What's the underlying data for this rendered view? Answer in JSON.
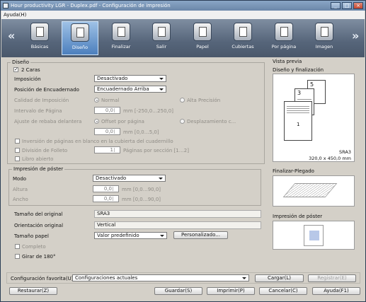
{
  "window": {
    "title": "Hour productivity LGR - Duplex.pdf - Configuración de impresión",
    "menu": "Ayuda(H)"
  },
  "toolbar": {
    "prev": "«",
    "next": "»",
    "tabs": [
      {
        "label": "Básicas"
      },
      {
        "label": "Diseño"
      },
      {
        "label": "Finalizar"
      },
      {
        "label": "Salir"
      },
      {
        "label": "Papel"
      },
      {
        "label": "Cubiertas"
      },
      {
        "label": "Por página"
      },
      {
        "label": "Imagen"
      }
    ]
  },
  "design": {
    "title": "Diseño",
    "duplex": "2 Caras",
    "imposition_label": "Imposición",
    "imposition_value": "Desactivado",
    "binding_label": "Posición de Encuadernado",
    "binding_value": "Encuadernado Arriba",
    "quality_label": "Calidad de Imposición",
    "quality_normal": "Normal",
    "quality_high": "Alta Precisión",
    "interval_label": "Intervalo de Página",
    "interval_value": "0,0",
    "interval_range": "mm [-250,0…250,0]",
    "bleed_label": "Ajuste de rebaba delantera",
    "bleed_offset": "Offset por página",
    "bleed_shift": "Desplazamiento c...",
    "bleed_value": "0,0",
    "bleed_range": "mm [0,0…5,0]",
    "insert_blank": "Inversión de páginas en blanco en la cubierta del cuadernillo",
    "booklet_div": "División de Folleto",
    "pages_per_section": "1",
    "pages_per_section_label": "Páginas por sección [1…2]",
    "open_book": "Libro abierto"
  },
  "poster": {
    "title": "Impresión de póster",
    "mode_label": "Modo",
    "mode_value": "Desactivado",
    "height_label": "Altura",
    "height_value": "0,0",
    "height_range": "mm [0,0…90,0]",
    "width_label": "Ancho",
    "width_value": "0,0",
    "width_range": "mm [0,0…90,0]"
  },
  "original": {
    "size_label": "Tamaño del original",
    "size_value": "SRA3",
    "orient_label": "Orientación original",
    "orient_value": "Vertical",
    "paper_label": "Tamaño papel",
    "paper_value": "Valor predefinido",
    "custom_btn": "Personalizado...",
    "complete": "Completo",
    "rotate": "Girar de 180°"
  },
  "preview": {
    "title": "Vista previa",
    "design_title": "Diseño y finalización",
    "p1": "1",
    "p3": "3",
    "p5": "5",
    "paper": "SRA3",
    "paper_dims": "320,0 x 450,0 mm",
    "fold_title": "Finalizar-Plegado",
    "poster_title": "Impresión de póster"
  },
  "favorites": {
    "label": "Configuración favorita(U)",
    "value": "Configuraciones actuales",
    "load": "Cargar(L)",
    "register": "Registrar(E)"
  },
  "footer": {
    "restore": "Restaurar(Z)",
    "save": "Guardar(S)",
    "print": "Imprimir(P)",
    "cancel": "Cancelar(C)",
    "help": "Ayuda(F1)"
  }
}
